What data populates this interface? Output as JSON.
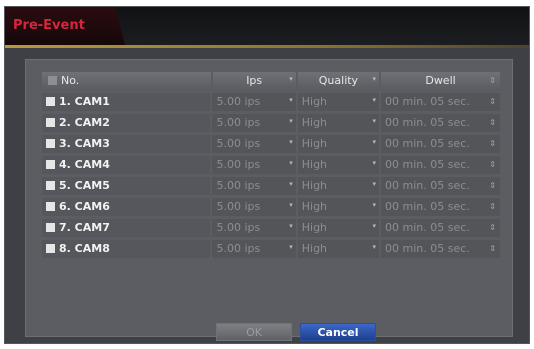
{
  "window": {
    "title": "Pre-Event"
  },
  "columns": {
    "no": "No.",
    "ips": "Ips",
    "quality": "Quality",
    "dwell": "Dwell"
  },
  "rows": [
    {
      "label": "1. CAM1",
      "ips": "5.00 ips",
      "quality": "High",
      "dwell": "00 min. 05 sec."
    },
    {
      "label": "2. CAM2",
      "ips": "5.00 ips",
      "quality": "High",
      "dwell": "00 min. 05 sec."
    },
    {
      "label": "3. CAM3",
      "ips": "5.00 ips",
      "quality": "High",
      "dwell": "00 min. 05 sec."
    },
    {
      "label": "4. CAM4",
      "ips": "5.00 ips",
      "quality": "High",
      "dwell": "00 min. 05 sec."
    },
    {
      "label": "5. CAM5",
      "ips": "5.00 ips",
      "quality": "High",
      "dwell": "00 min. 05 sec."
    },
    {
      "label": "6. CAM6",
      "ips": "5.00 ips",
      "quality": "High",
      "dwell": "00 min. 05 sec."
    },
    {
      "label": "7. CAM7",
      "ips": "5.00 ips",
      "quality": "High",
      "dwell": "00 min. 05 sec."
    },
    {
      "label": "8. CAM8",
      "ips": "5.00 ips",
      "quality": "High",
      "dwell": "00 min. 05 sec."
    }
  ],
  "buttons": {
    "ok": "OK",
    "cancel": "Cancel"
  },
  "colors": {
    "title": "#d8243c",
    "accent": "#b79a3c",
    "cancel": "#2b55b8"
  }
}
